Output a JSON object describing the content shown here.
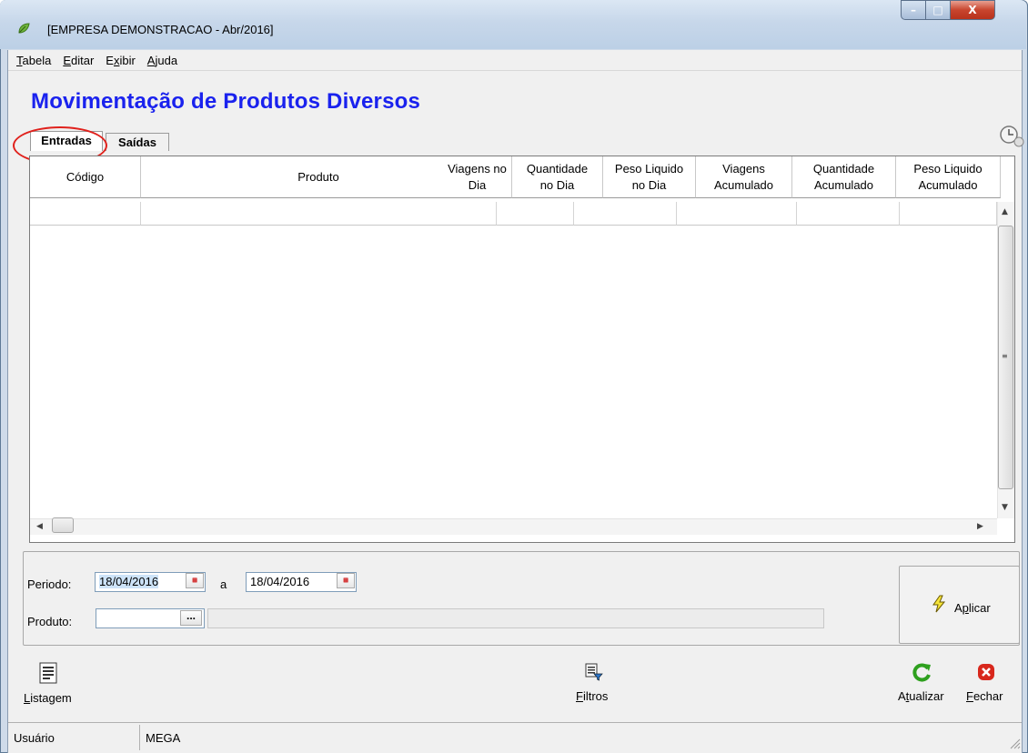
{
  "window": {
    "title": "[EMPRESA DEMONSTRACAO - Abr/2016]",
    "minimize_glyph": "–",
    "maximize_glyph": "□",
    "close_glyph": "X"
  },
  "menu": {
    "items": [
      {
        "u": "T",
        "rest": "abela"
      },
      {
        "u": "E",
        "rest": "ditar"
      },
      {
        "pre": "E",
        "u": "x",
        "rest": "ibir"
      },
      {
        "u": "A",
        "rest": "juda"
      }
    ]
  },
  "page_title": "Movimentação de Produtos Diversos",
  "tabs": {
    "entradas": "Entradas",
    "saidas": "Saídas"
  },
  "grid": {
    "headers": [
      "Código",
      "Produto",
      "Viagens no Dia",
      "Quantidade no Dia",
      "Peso Liquido no Dia",
      "Viagens Acumulado",
      "Quantidade Acumulado",
      "Peso Liquido Acumulado"
    ]
  },
  "filters": {
    "periodo_label": "Periodo:",
    "date_from": "18/04/2016",
    "a_label": "a",
    "date_to": "18/04/2016",
    "produto_label": "Produto:",
    "produto_btn": "...",
    "aplicar_label": "Aplicar",
    "aplicar_pre": "A",
    "aplicar_u": "p",
    "aplicar_rest": "licar"
  },
  "toolbar": {
    "listagem": {
      "u": "L",
      "rest": "istagem"
    },
    "filtros": {
      "u": "F",
      "rest": "iltros"
    },
    "atualizar": {
      "pre": "A",
      "u": "t",
      "rest": "ualizar"
    },
    "fechar": {
      "u": "F",
      "rest": "echar"
    }
  },
  "status": {
    "user_label": "Usuário",
    "user_value": "MEGA"
  },
  "colors": {
    "title_blue": "#1a22ee",
    "highlight_red": "#e0211c"
  }
}
